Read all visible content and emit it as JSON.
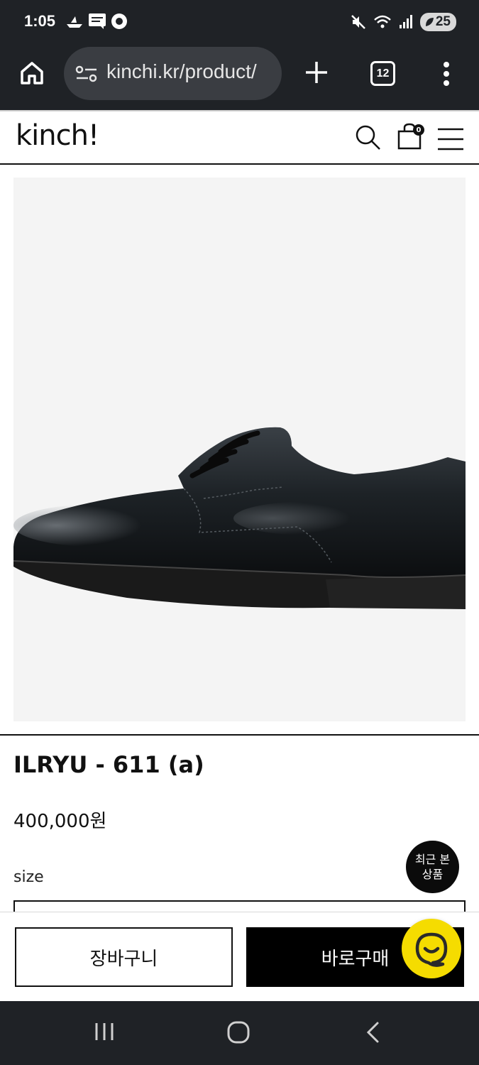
{
  "status_bar": {
    "time": "1:05",
    "battery": "25"
  },
  "browser": {
    "url": "kinchi.kr/product/",
    "tab_count": "12"
  },
  "site": {
    "logo": "kinch!",
    "cart_count": "0"
  },
  "product": {
    "name": "ILRYU - 611 (a)",
    "price": "400,000원",
    "size_label": "size"
  },
  "recent_items": {
    "line1": "최근 본",
    "line2": "상품"
  },
  "actions": {
    "cart_label": "장바구니",
    "buy_label": "바로구매"
  },
  "colors": {
    "chat_button": "#f5dc00",
    "buy_button": "#000000",
    "system_bar": "#1f2226"
  },
  "icons": {
    "status": [
      "boat-icon",
      "message-icon",
      "record-icon",
      "mute-icon",
      "wifi-icon",
      "signal-icon"
    ],
    "browser": [
      "home-icon",
      "site-settings-icon",
      "new-tab-icon",
      "tabs-icon",
      "more-icon"
    ],
    "header": [
      "search-icon",
      "shopping-bag-icon",
      "menu-icon"
    ],
    "nav": [
      "recents-icon",
      "home-nav-icon",
      "back-icon"
    ]
  }
}
